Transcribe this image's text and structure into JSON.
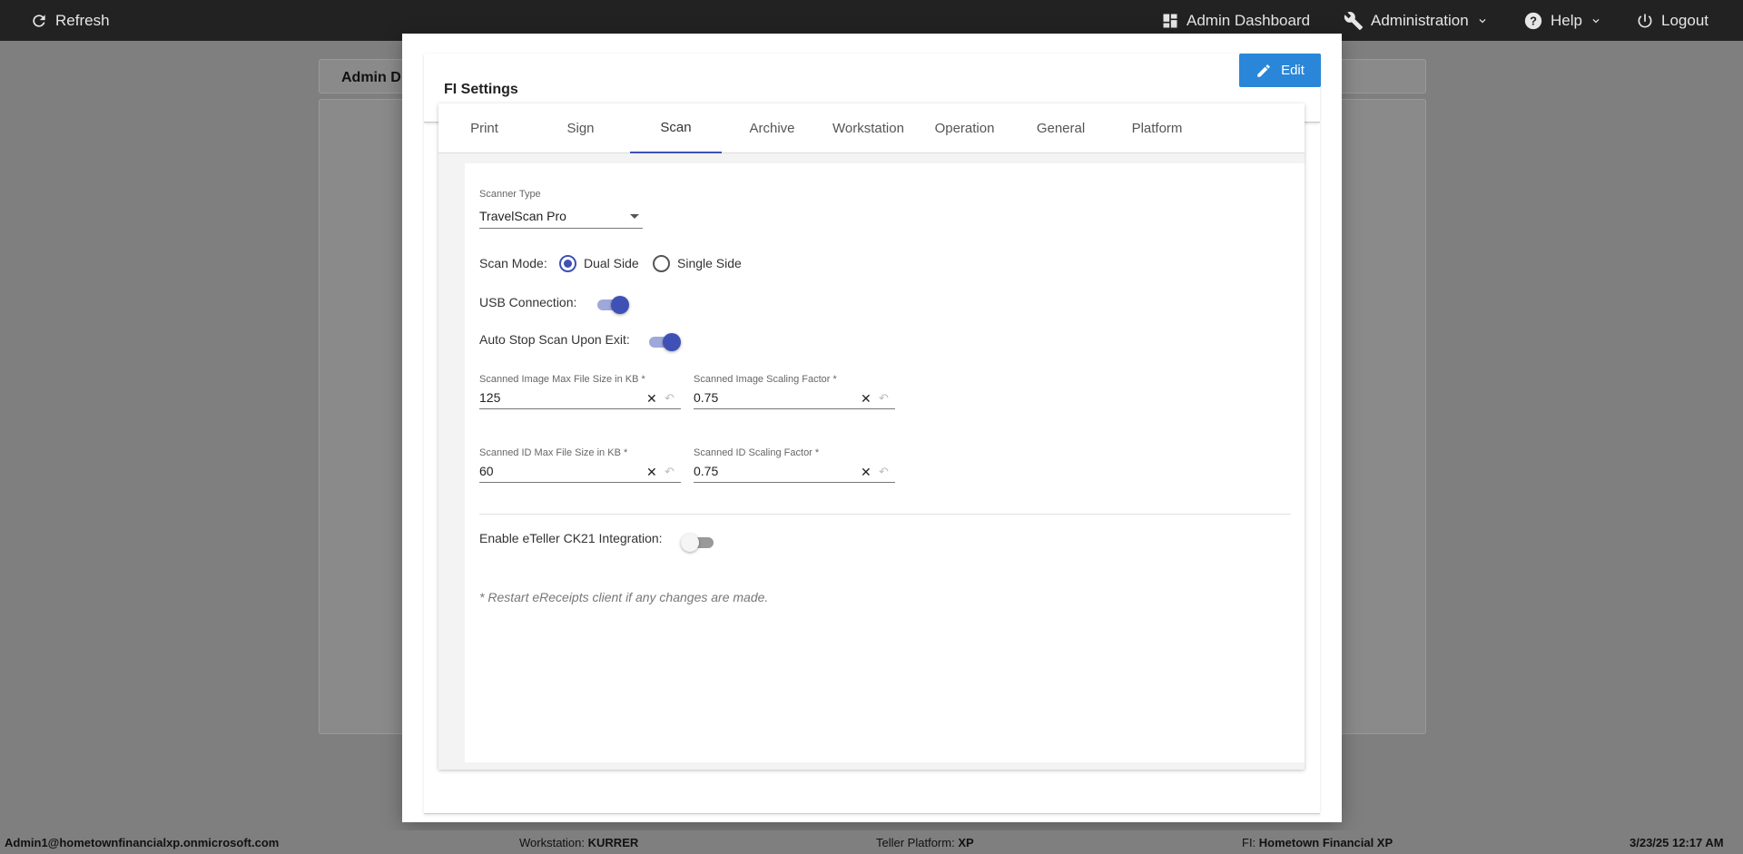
{
  "topbar": {
    "refresh_label": "Refresh",
    "admin_dashboard_label": "Admin Dashboard",
    "administration_label": "Administration",
    "help_label": "Help",
    "logout_label": "Logout"
  },
  "background": {
    "panel_title": "Admin D"
  },
  "dialog": {
    "title": "FI Settings",
    "edit_label": "Edit",
    "tabs": [
      {
        "label": "Print"
      },
      {
        "label": "Sign"
      },
      {
        "label": "Scan",
        "active": true
      },
      {
        "label": "Archive"
      },
      {
        "label": "Workstation"
      },
      {
        "label": "Operation"
      },
      {
        "label": "General"
      },
      {
        "label": "Platform"
      }
    ],
    "scan": {
      "scanner_type_label": "Scanner Type",
      "scanner_type_value": "TravelScan Pro",
      "scan_mode_label": "Scan Mode:",
      "scan_mode_options": [
        "Dual Side",
        "Single Side"
      ],
      "scan_mode_selected": "Dual Side",
      "usb_connection_label": "USB Connection:",
      "usb_connection_on": true,
      "auto_stop_label": "Auto Stop Scan Upon Exit:",
      "auto_stop_on": true,
      "image_max_size_label": "Scanned Image Max File Size in KB *",
      "image_max_size_value": "125",
      "image_scaling_label": "Scanned Image Scaling Factor *",
      "image_scaling_value": "0.75",
      "id_max_size_label": "Scanned ID Max File Size in KB *",
      "id_max_size_value": "60",
      "id_scaling_label": "Scanned ID Scaling Factor *",
      "id_scaling_value": "0.75",
      "eteller_label": "Enable eTeller CK21 Integration:",
      "eteller_on": false,
      "restart_note": "* Restart eReceipts client if any changes are made."
    }
  },
  "statusbar": {
    "user": "Admin1@hometownfinancialxp.onmicrosoft.com",
    "workstation_label": "Workstation:",
    "workstation_value": "KURRER",
    "platform_label": "Teller Platform:",
    "platform_value": "XP",
    "fi_label": "FI:",
    "fi_value": "Hometown Financial XP",
    "datetime": "3/23/25 12:17 AM"
  },
  "colors": {
    "accent": "#3f51b5",
    "edit_button": "#2a86d8",
    "topbar": "#222222"
  }
}
